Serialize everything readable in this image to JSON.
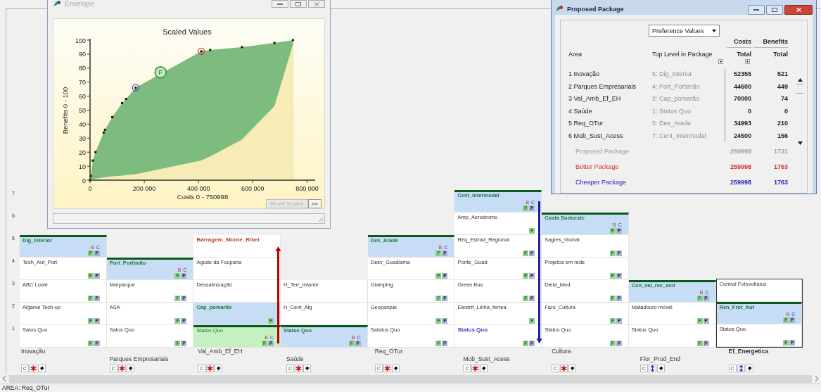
{
  "envelope": {
    "title": "Envelope",
    "chart_data": {
      "type": "area",
      "title": "Scaled Values",
      "xlabel": "Costs 0 - 750998",
      "ylabel": "Benefits 0 - 100",
      "x": [
        0,
        3000,
        10000,
        20000,
        50000,
        55000,
        82000,
        118000,
        133000,
        168000,
        410000,
        443000,
        560000,
        680000,
        748000
      ],
      "series": [
        {
          "color": "#7dbb7f",
          "values": [
            0,
            3,
            14,
            20,
            34,
            36,
            45,
            55,
            58,
            66,
            92,
            93,
            95,
            98,
            100
          ]
        },
        {
          "color": "#f7ebb6",
          "values": [
            0,
            0.2,
            0.6,
            1,
            2,
            2.1,
            2.7,
            3.3,
            3.6,
            4.3,
            14,
            17,
            29,
            53,
            97
          ]
        }
      ],
      "xlim": [
        0,
        830000
      ],
      "ylim": [
        0,
        100
      ],
      "xticks": [
        {
          "value": 0,
          "label": "0"
        },
        {
          "value": 200000,
          "label": "200 000"
        },
        {
          "value": 400000,
          "label": "400 000"
        },
        {
          "value": 600000,
          "label": "600 000"
        },
        {
          "value": 800000,
          "label": "800 000"
        }
      ],
      "yticks": [
        0,
        10,
        20,
        30,
        40,
        50,
        60,
        70,
        80,
        90,
        100
      ]
    },
    "marker_label": "F",
    "buttons": [
      {
        "label": "Reset Scales",
        "disabled": true
      },
      {
        "label": ">>",
        "disabled": false
      }
    ]
  },
  "package": {
    "title": "Proposed Package",
    "dropdown": "Preference Values",
    "group_headers": [
      "Costs",
      "Benefits"
    ],
    "headers": [
      "Area",
      "Top Level in Package",
      "Total",
      "Total"
    ],
    "rows": [
      {
        "area": "1 Inovação",
        "top_level": "5: Dig_Interior",
        "costs": "52355",
        "benefits": "521"
      },
      {
        "area": "2 Parques Empresariais",
        "top_level": "4: Port_Portimão",
        "costs": "44600",
        "benefits": "449"
      },
      {
        "area": "3 Val_Amb_Ef_EH",
        "top_level": "2: Cap_pomarão",
        "costs": "70000",
        "benefits": "74"
      },
      {
        "area": "4 Saúde",
        "top_level": "1: Statos Quo",
        "costs": "0",
        "benefits": "0"
      },
      {
        "area": "5 Req_OTur",
        "top_level": "5: Des_Arade",
        "costs": "34993",
        "benefits": "210"
      },
      {
        "area": "6 Mob_Sust_Acess",
        "top_level": "7: Cent_Intermodal",
        "costs": "24500",
        "benefits": "156"
      }
    ],
    "summary": [
      {
        "kind": "proposed",
        "label": "Proposed Package",
        "costs": "260998",
        "benefits": "1731"
      },
      {
        "kind": "better",
        "label": "Better Package",
        "costs": "259998",
        "benefits": "1763"
      },
      {
        "kind": "cheaper",
        "label": "Cheaper Package",
        "costs": "259998",
        "benefits": "1763"
      }
    ]
  },
  "levels": [
    "7",
    "6",
    "5",
    "4",
    "3",
    "2",
    "1"
  ],
  "columns": [
    {
      "label": "Inovação",
      "focused": false,
      "tool_letter": "C",
      "kind": "star",
      "cells": [
        {
          "label": "Dig_Interior",
          "selected": true,
          "current": false,
          "boundary": true,
          "upper": [
            "B",
            "C"
          ],
          "lower": [
            "F",
            "P"
          ]
        },
        {
          "label": "Tech_Aut_Port",
          "selected": false,
          "current": false,
          "boundary": false,
          "lower": [
            "F",
            "P"
          ]
        },
        {
          "label": "ABC Loulé",
          "selected": false,
          "current": false,
          "boundary": false,
          "lower": [
            "F",
            "P"
          ]
        },
        {
          "label": "Algarve Tech-up",
          "selected": false,
          "current": false,
          "boundary": false,
          "lower": [
            "F",
            "P"
          ]
        },
        {
          "label": "Satos Quo",
          "selected": false,
          "current": false,
          "boundary": false,
          "lower": [
            "F",
            "P"
          ]
        }
      ]
    },
    {
      "label": "Parques Empresariais",
      "focused": false,
      "tool_letter": "C",
      "kind": "star",
      "cells": [
        {
          "label": "Port_Portimão",
          "selected": true,
          "current": false,
          "boundary": true,
          "upper": [
            "B",
            "C"
          ],
          "lower": [
            "F",
            "P"
          ]
        },
        {
          "label": "Marparque",
          "selected": false,
          "current": false,
          "boundary": false,
          "lower": [
            "F",
            "P"
          ]
        },
        {
          "label": "ASA",
          "selected": false,
          "current": false,
          "boundary": false,
          "lower": [
            "F",
            "P"
          ]
        },
        {
          "label": "Satos Quo",
          "selected": false,
          "current": false,
          "boundary": false,
          "lower": [
            "F",
            "P"
          ]
        }
      ]
    },
    {
      "label": "Val_Amb_Ef_EH",
      "focused": false,
      "tool_letter": "C",
      "kind": "star",
      "arrow": {
        "color": "#b80000"
      },
      "cells": [
        {
          "label": "Barragem_Monte_Ribei",
          "selected": false,
          "current": false,
          "boundary": false,
          "color": "#c83a2a"
        },
        {
          "label": "Agude da Foupana",
          "selected": false,
          "current": false,
          "boundary": false
        },
        {
          "label": "Dessalinização",
          "selected": false,
          "current": false,
          "boundary": false
        },
        {
          "label": "Cap_pomarão",
          "selected": true,
          "current": false,
          "boundary": false,
          "lower": [
            "F"
          ]
        },
        {
          "label": "Statos Quo",
          "selected": false,
          "current": true,
          "boundary": true,
          "upper": [
            "B",
            "C"
          ],
          "lower": [
            "F",
            "P"
          ]
        }
      ]
    },
    {
      "label": "Saúde",
      "focused": false,
      "tool_letter": "C",
      "kind": "star",
      "cells": [
        {
          "label": "H_Terr_Infante",
          "selected": false,
          "current": false,
          "boundary": false
        },
        {
          "label": "H_Cent_Alg",
          "selected": false,
          "current": false,
          "boundary": false
        },
        {
          "label": "Statos Quo",
          "selected": true,
          "current": false,
          "boundary": true,
          "upper": [
            "B",
            "C"
          ],
          "lower": [
            "F",
            "P"
          ]
        }
      ]
    },
    {
      "label": "Req_OTur",
      "focused": false,
      "tool_letter": "C",
      "kind": "star",
      "cells": [
        {
          "label": "Des_Arade",
          "selected": true,
          "current": false,
          "boundary": true,
          "upper": [
            "B",
            "C"
          ],
          "lower": [
            "F",
            "P"
          ]
        },
        {
          "label": "Desv_Guadiama",
          "selected": false,
          "current": false,
          "boundary": false,
          "lower": [
            "F",
            "P"
          ]
        },
        {
          "label": "Glamping",
          "selected": false,
          "current": false,
          "boundary": false,
          "lower": [
            "F",
            "P"
          ]
        },
        {
          "label": "Geoparque",
          "selected": false,
          "current": false,
          "boundary": false,
          "lower": [
            "F",
            "P"
          ]
        },
        {
          "label": "Satatus Quo",
          "selected": false,
          "current": false,
          "boundary": false,
          "lower": [
            "F",
            "P"
          ]
        }
      ]
    },
    {
      "label": "Mob_Sust_Acess",
      "focused": false,
      "tool_letter": "C",
      "kind": "star",
      "arrow": {
        "color": "#1c1c98"
      },
      "cells": [
        {
          "label": "Cent_Intermodal",
          "selected": true,
          "current": false,
          "boundary": true,
          "upper": [
            "B",
            "C"
          ],
          "lower": [
            "F",
            "P"
          ]
        },
        {
          "label": "Amp_Aerodromo",
          "selected": false,
          "current": false,
          "boundary": false,
          "lower": [
            "F"
          ]
        },
        {
          "label": "Req_Estrad_Regional",
          "selected": false,
          "current": false,
          "boundary": false,
          "lower": [
            "F",
            "P"
          ]
        },
        {
          "label": "Ponte_Guad",
          "selected": false,
          "current": false,
          "boundary": false,
          "lower": [
            "F",
            "P"
          ]
        },
        {
          "label": "Green Bus",
          "selected": false,
          "current": false,
          "boundary": false,
          "lower": [
            "F",
            "P"
          ]
        },
        {
          "label": "Elestrif_Linha_ferrea",
          "selected": false,
          "current": false,
          "boundary": false,
          "lower": [
            "F"
          ]
        },
        {
          "label": "Status Quo",
          "selected": false,
          "current": false,
          "boundary": false,
          "color": "#3a3ac8",
          "lower": [
            "F",
            "P"
          ]
        }
      ]
    },
    {
      "label": "Cultura",
      "focused": false,
      "tool_letter": "C",
      "kind": "star",
      "cells": [
        {
          "label": "Costa Sudoeste",
          "selected": true,
          "current": false,
          "boundary": true,
          "upper": [
            "B",
            "C"
          ],
          "lower": [
            "F",
            "P"
          ]
        },
        {
          "label": "Sagres_Global",
          "selected": false,
          "current": false,
          "boundary": false,
          "lower": [
            "F",
            "P"
          ]
        },
        {
          "label": "Projetos em rede",
          "selected": false,
          "current": false,
          "boundary": false,
          "lower": [
            "F",
            "P"
          ]
        },
        {
          "label": "Dieta_Med",
          "selected": false,
          "current": false,
          "boundary": false,
          "lower": [
            "F",
            "P"
          ]
        },
        {
          "label": "Faro_Cultura",
          "selected": false,
          "current": false,
          "boundary": false,
          "lower": [
            "F",
            "P"
          ]
        },
        {
          "label": "Status Quo",
          "selected": false,
          "current": false,
          "boundary": false,
          "lower": [
            "F",
            "P"
          ]
        }
      ]
    },
    {
      "label": "Flor_Prod_End",
      "focused": false,
      "tool_letter": "C",
      "kind": "updown",
      "cells": [
        {
          "label": "Cen_val_rec_end",
          "selected": true,
          "current": false,
          "boundary": true,
          "upper": [
            "B",
            "C"
          ],
          "lower": [
            "F",
            "P"
          ]
        },
        {
          "label": "Matadouro móvel",
          "selected": false,
          "current": false,
          "boundary": false,
          "lower": [
            "F",
            "P"
          ]
        },
        {
          "label": "Status Quo",
          "selected": false,
          "current": false,
          "boundary": false,
          "lower": [
            "F",
            "P"
          ]
        }
      ]
    },
    {
      "label": "Ef_Energetica",
      "focused": true,
      "tool_letter": "C",
      "kind": "updown",
      "cells": [
        {
          "label": "Central Fotovoltaica",
          "selected": false,
          "current": false,
          "boundary": false
        },
        {
          "label": "Ren_Frot_Aut",
          "selected": true,
          "current": false,
          "boundary": true,
          "upper": [
            "B",
            "C"
          ],
          "lower": [
            "F",
            "P"
          ]
        },
        {
          "label": "Status Quo",
          "selected": false,
          "current": false,
          "boundary": false,
          "lower": [
            "F",
            "P"
          ]
        }
      ]
    }
  ],
  "status_bar": "AREA: Req_OTur"
}
